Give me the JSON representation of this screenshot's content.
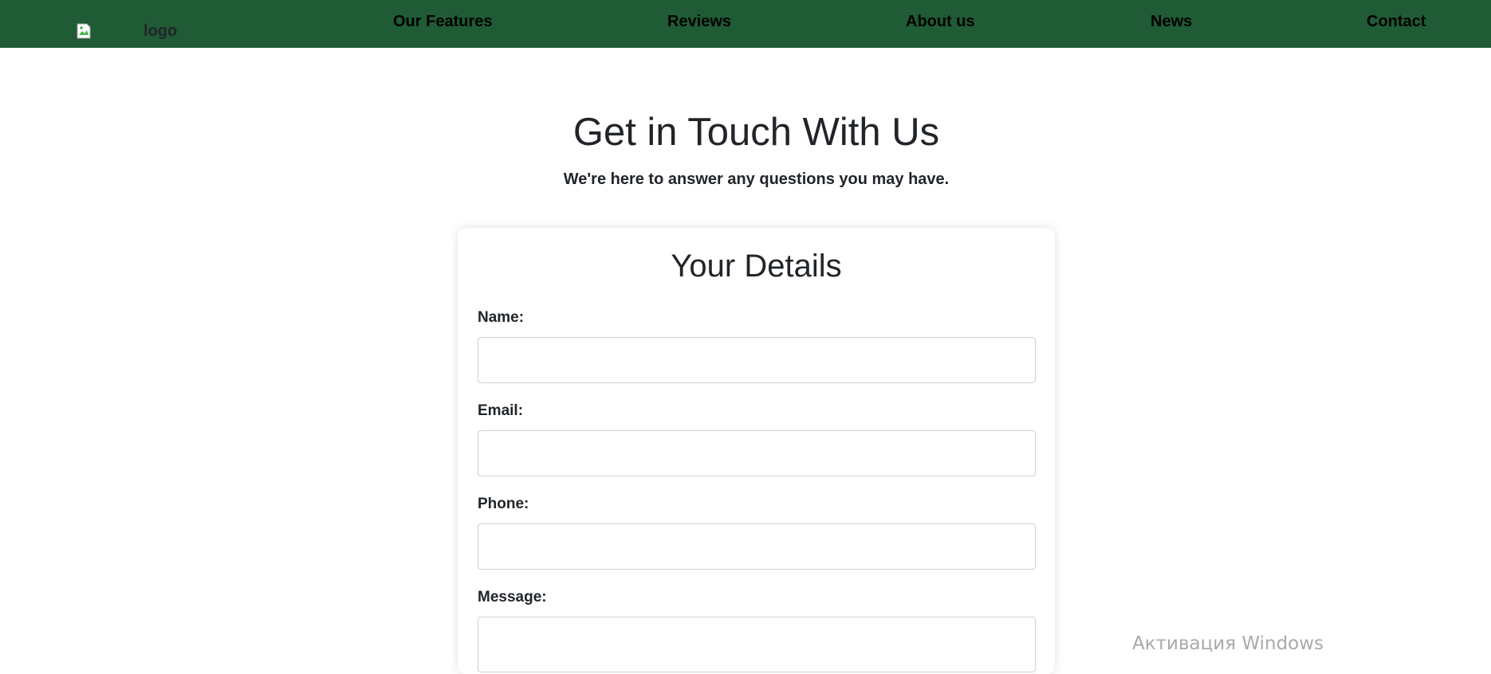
{
  "navbar": {
    "background": "#1f5b35",
    "logo_alt": "logo",
    "links": [
      "Our Features",
      "Reviews",
      "About us",
      "News",
      "Contact"
    ]
  },
  "hero": {
    "title": "Get in Touch With Us",
    "subtitle": "We're here to answer any questions you may have."
  },
  "form": {
    "title": "Your Details",
    "fields": [
      {
        "label": "Name:",
        "value": ""
      },
      {
        "label": "Email:",
        "value": ""
      },
      {
        "label": "Phone:",
        "value": ""
      },
      {
        "label": "Message:",
        "value": ""
      }
    ]
  },
  "watermark": "Активация Windows"
}
